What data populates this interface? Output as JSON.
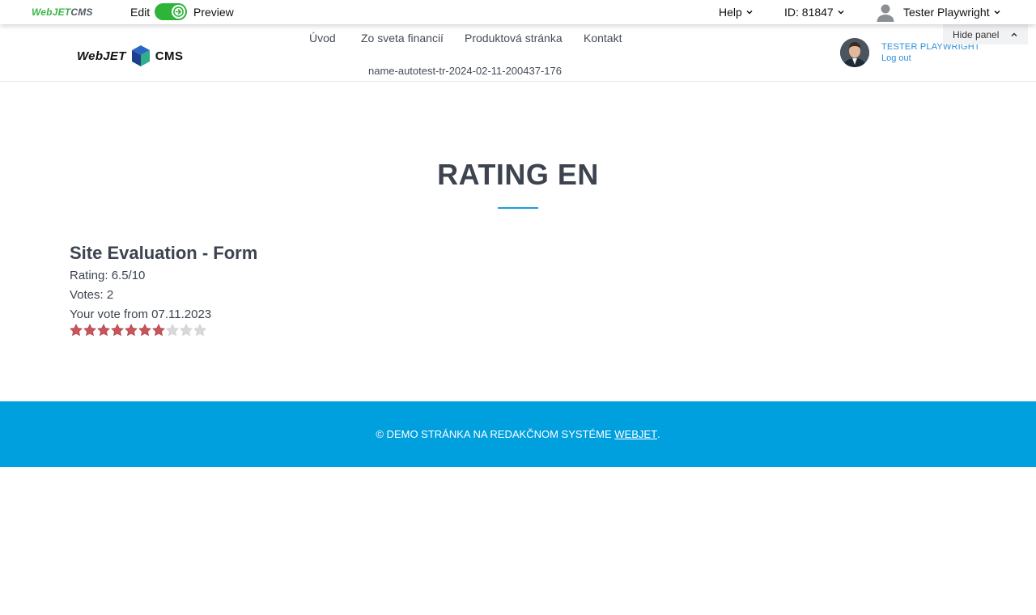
{
  "admin_bar": {
    "logo_part1": "WebJET",
    "logo_part2": "CMS",
    "edit_label": "Edit",
    "preview_label": "Preview",
    "help_label": "Help",
    "id_label": "ID: 81847",
    "user_label": "Tester Playwright"
  },
  "header": {
    "logo_word": "WebJET",
    "logo_cms": "CMS",
    "nav": [
      "Úvod",
      "Zo sveta financií",
      "Produktová stránka",
      "Kontakt"
    ],
    "nav_sub": "name-autotest-tr-2024-02-11-200437-176",
    "hide_panel": "Hide panel",
    "user_name": "TESTER PLAYWRIGHT",
    "logout": "Log out"
  },
  "main": {
    "page_title": "RATING EN",
    "form_title": "Site Evaluation - Form",
    "rating": "Rating: 6.5/10",
    "votes": "Votes: 2",
    "your_vote": "Your vote from 07.11.2023",
    "stars_filled": 7,
    "stars_total": 10
  },
  "footer": {
    "text": "© DEMO STRÁNKA NA REDAKČNOM SYSTÉME ",
    "link": "WEBJET",
    "suffix": "."
  },
  "colors": {
    "accent_green": "#2fb43a",
    "link_blue": "#2e8fd8",
    "footer_blue": "#00a0df",
    "star_filled": "#c9545a",
    "star_empty": "#d9d9d9"
  }
}
